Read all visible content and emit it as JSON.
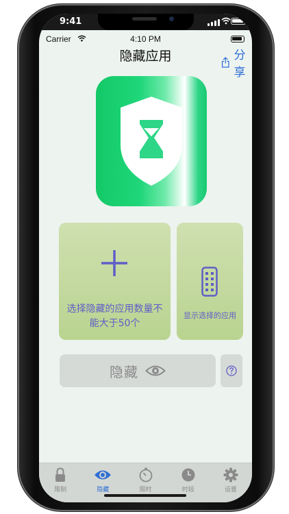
{
  "system": {
    "time": "9:41"
  },
  "status": {
    "carrier": "Carrier",
    "time": "4:10 PM"
  },
  "nav": {
    "title": "隐藏应用",
    "share_label": "分享"
  },
  "cards": {
    "select_text": "选择隐藏的应用数量不能大于50个",
    "show_text": "显示选择的应用"
  },
  "hide_button": {
    "label": "隐藏"
  },
  "tabs": [
    {
      "label": "限制",
      "icon": "lock-icon",
      "active": false
    },
    {
      "label": "隐藏",
      "icon": "eye-icon",
      "active": true
    },
    {
      "label": "限时",
      "icon": "stopwatch-icon",
      "active": false
    },
    {
      "label": "时段",
      "icon": "clock-icon",
      "active": false
    },
    {
      "label": "设置",
      "icon": "gear-icon",
      "active": false
    }
  ],
  "colors": {
    "accent": "#2f6fd6",
    "card_text": "#5f5ec7",
    "hero_green": "#13c866",
    "card_green": "#c3d9a0"
  }
}
